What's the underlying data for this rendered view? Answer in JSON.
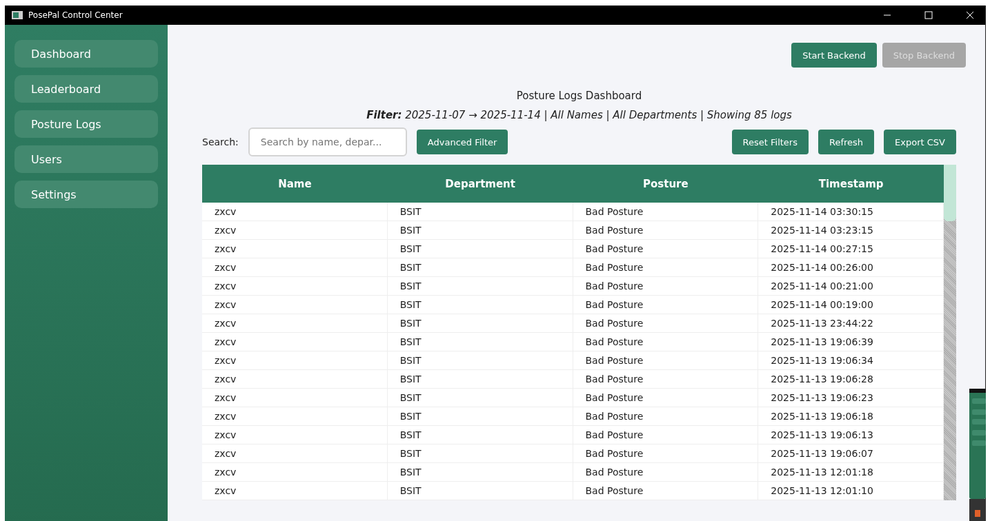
{
  "window": {
    "title": "PosePal Control Center"
  },
  "sidebar": {
    "items": [
      {
        "label": "Dashboard",
        "selected": false
      },
      {
        "label": "Leaderboard",
        "selected": false
      },
      {
        "label": "Posture Logs",
        "selected": false
      },
      {
        "label": "Users",
        "selected": false
      },
      {
        "label": "Settings",
        "selected": false
      }
    ]
  },
  "backend_buttons": [
    {
      "label": "Start Backend",
      "disabled": false
    },
    {
      "label": "Stop Backend",
      "disabled": true
    }
  ],
  "heading": "Posture Logs Dashboard",
  "filter_summary": "**Filter:** 2025-11-07 → 2025-11-14 | All Names | All Departments | Showing 85 logs",
  "search": {
    "label": "Search:",
    "placeholder": "Search by name, depar..."
  },
  "toolbar_buttons": [
    "Advanced Filter",
    "Reset Filters",
    "Refresh",
    "Export CSV"
  ],
  "table": {
    "columns": [
      "Name",
      "Department",
      "Posture",
      "Timestamp"
    ],
    "rows": [
      [
        "zxcv",
        "BSIT",
        "Bad Posture",
        "2025-11-14 03:30:15"
      ],
      [
        "zxcv",
        "BSIT",
        "Bad Posture",
        "2025-11-14 03:23:15"
      ],
      [
        "zxcv",
        "BSIT",
        "Bad Posture",
        "2025-11-14 00:27:15"
      ],
      [
        "zxcv",
        "BSIT",
        "Bad Posture",
        "2025-11-14 00:26:00"
      ],
      [
        "zxcv",
        "BSIT",
        "Bad Posture",
        "2025-11-14 00:21:00"
      ],
      [
        "zxcv",
        "BSIT",
        "Bad Posture",
        "2025-11-14 00:19:00"
      ],
      [
        "zxcv",
        "BSIT",
        "Bad Posture",
        "2025-11-13 23:44:22"
      ],
      [
        "zxcv",
        "BSIT",
        "Bad Posture",
        "2025-11-13 19:06:39"
      ],
      [
        "zxcv",
        "BSIT",
        "Bad Posture",
        "2025-11-13 19:06:34"
      ],
      [
        "zxcv",
        "BSIT",
        "Bad Posture",
        "2025-11-13 19:06:28"
      ],
      [
        "zxcv",
        "BSIT",
        "Bad Posture",
        "2025-11-13 19:06:23"
      ],
      [
        "zxcv",
        "BSIT",
        "Bad Posture",
        "2025-11-13 19:06:18"
      ],
      [
        "zxcv",
        "BSIT",
        "Bad Posture",
        "2025-11-13 19:06:13"
      ],
      [
        "zxcv",
        "BSIT",
        "Bad Posture",
        "2025-11-13 19:06:07"
      ],
      [
        "zxcv",
        "BSIT",
        "Bad Posture",
        "2025-11-13 12:01:18"
      ],
      [
        "zxcv",
        "BSIT",
        "Bad Posture",
        "2025-11-13 12:01:10"
      ]
    ]
  }
}
